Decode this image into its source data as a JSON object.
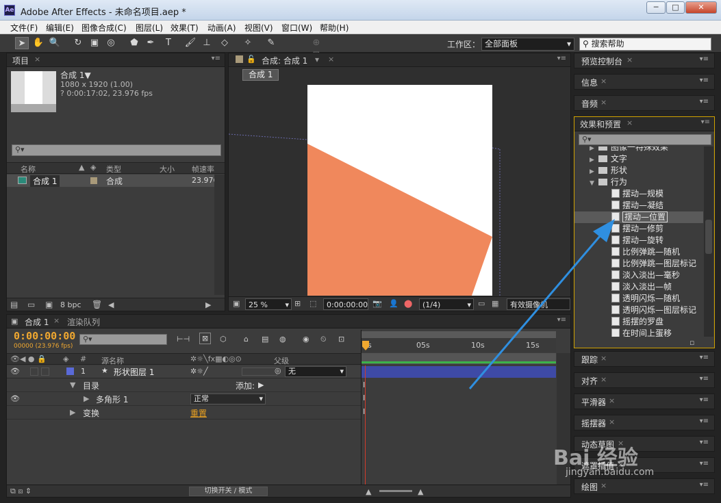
{
  "window": {
    "title": "Adobe After Effects - 未命名项目.aep *",
    "app_icon": "Ae",
    "buttons": [
      "─",
      "□",
      "✕"
    ]
  },
  "menu": [
    "文件(F)",
    "编辑(E)",
    "图像合成(C)",
    "图层(L)",
    "效果(T)",
    "动画(A)",
    "视图(V)",
    "窗口(W)",
    "帮助(H)"
  ],
  "toolbar": {
    "workspace_label": "工作区：",
    "workspace_value": "全部面板",
    "search_placeholder": "搜索帮助"
  },
  "project": {
    "tab": "项目",
    "comp_name": "合成 1▼",
    "comp_size": "1080 x 1920 (1.00)",
    "comp_duration": "? 0:00:17:02, 23.976 fps",
    "columns": [
      "名称",
      "类型",
      "大小",
      "帧速率"
    ],
    "row": {
      "name": "合成 1",
      "type": "合成",
      "fps": "23.976"
    },
    "bpc": "8 bpc"
  },
  "composition": {
    "tab": "合成: 合成 1",
    "sub_tab": "合成 1",
    "zoom": "25 %",
    "timecode": "0:00:00:00",
    "resolution": "(1/4)",
    "camera": "有效摄像机",
    "colors": {
      "canvas": "#ffffff",
      "shape": "#f0885c"
    }
  },
  "right_panels": {
    "preview": "预览控制台",
    "info": "信息",
    "audio": "音频",
    "effects": "效果和预置",
    "effects_tree": [
      {
        "label": "图像一特殊效果",
        "level": 1,
        "kind": "folder",
        "arrow": "▶"
      },
      {
        "label": "文字",
        "level": 1,
        "kind": "folder",
        "arrow": "▶"
      },
      {
        "label": "形状",
        "level": 1,
        "kind": "folder",
        "arrow": "▶"
      },
      {
        "label": "行为",
        "level": 1,
        "kind": "folder",
        "arrow": "▼"
      },
      {
        "label": "摆动—规模",
        "level": 2,
        "kind": "file"
      },
      {
        "label": "摆动—凝结",
        "level": 2,
        "kind": "file"
      },
      {
        "label": "摆动—位置",
        "level": 2,
        "kind": "file",
        "selected": true
      },
      {
        "label": "摆动—修剪",
        "level": 2,
        "kind": "file"
      },
      {
        "label": "摆动—旋转",
        "level": 2,
        "kind": "file"
      },
      {
        "label": "比例弹跳—随机",
        "level": 2,
        "kind": "file"
      },
      {
        "label": "比例弹跳—图层标记",
        "level": 2,
        "kind": "file"
      },
      {
        "label": "淡入淡出—毫秒",
        "level": 2,
        "kind": "file"
      },
      {
        "label": "淡入淡出—帧",
        "level": 2,
        "kind": "file"
      },
      {
        "label": "透明闪烁—随机",
        "level": 2,
        "kind": "file"
      },
      {
        "label": "透明闪烁—图层标记",
        "level": 2,
        "kind": "file"
      },
      {
        "label": "摇摆的罗盘",
        "level": 2,
        "kind": "file"
      },
      {
        "label": "在时间上蛋移",
        "level": 2,
        "kind": "file"
      }
    ],
    "track": "跟踪",
    "align": "对齐",
    "smoother": "平滑器",
    "wiggler": "摇摆器",
    "motion_sketch": "动态草图",
    "mask_interp": "遮罩插值",
    "brushes": "绘图"
  },
  "timeline": {
    "tabs": [
      "合成 1",
      "渲染队列"
    ],
    "timecode": "0:00:00:00",
    "frames": "00000 (23.976 fps)",
    "col_source": "源名称",
    "col_parent": "父级",
    "layer_num": "1",
    "layer_name": "形状图层 1",
    "parent_value": "无",
    "content": "目录",
    "add": "添加:",
    "polygon": "多角形 1",
    "mode": "正常",
    "transform": "变换",
    "reset": "重置",
    "ruler": [
      "0s",
      "05s",
      "10s",
      "15s"
    ],
    "footer": "切换开关 / 模式",
    "colors": {
      "layer_bar": "#3e4aa6",
      "playhead": "#d23a2a",
      "time": "#f0a830"
    }
  },
  "watermark": {
    "text": "Bai 经验",
    "url": "jingyan.baidu.com"
  }
}
